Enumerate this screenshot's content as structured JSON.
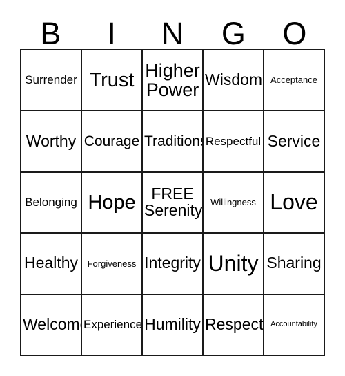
{
  "card": {
    "title": "BINGO",
    "header_letters": [
      "B",
      "I",
      "N",
      "G",
      "O"
    ],
    "free_space_label": "FREE",
    "colors": {
      "border": "#1a1a1a",
      "background": "#ffffff",
      "text": "#000000"
    },
    "rows": [
      [
        {
          "text": "Surrender",
          "size": "xs",
          "free": false
        },
        {
          "text": "Trust",
          "size": "lg",
          "free": false
        },
        {
          "text": "Higher\nPower",
          "size": "mdl",
          "free": false
        },
        {
          "text": "Wisdom",
          "size": "md",
          "free": false
        },
        {
          "text": "Acceptance",
          "size": "xxs",
          "free": false
        }
      ],
      [
        {
          "text": "Worthy",
          "size": "md",
          "free": false
        },
        {
          "text": "Courage",
          "size": "sm",
          "free": false
        },
        {
          "text": "Traditions",
          "size": "sm",
          "free": false
        },
        {
          "text": "Respectful",
          "size": "xs",
          "free": false
        },
        {
          "text": "Service",
          "size": "md",
          "free": false
        }
      ],
      [
        {
          "text": "Belonging",
          "size": "xs",
          "free": false
        },
        {
          "text": "Hope",
          "size": "lg",
          "free": false
        },
        {
          "text": "FREE\nSerenity",
          "size": "md",
          "free": true
        },
        {
          "text": "Willingness",
          "size": "xxs",
          "free": false
        },
        {
          "text": "Love",
          "size": "xl",
          "free": false
        }
      ],
      [
        {
          "text": "Healthy",
          "size": "md",
          "free": false
        },
        {
          "text": "Forgiveness",
          "size": "xxs",
          "free": false
        },
        {
          "text": "Integrity",
          "size": "md",
          "free": false
        },
        {
          "text": "Unity",
          "size": "xl",
          "free": false
        },
        {
          "text": "Sharing",
          "size": "md",
          "free": false
        }
      ],
      [
        {
          "text": "Welcome",
          "size": "md",
          "free": false
        },
        {
          "text": "Experience",
          "size": "xs",
          "free": false
        },
        {
          "text": "Humility",
          "size": "md",
          "free": false
        },
        {
          "text": "Respect",
          "size": "md",
          "free": false
        },
        {
          "text": "Accountability",
          "size": "tiny",
          "free": false
        }
      ]
    ]
  }
}
